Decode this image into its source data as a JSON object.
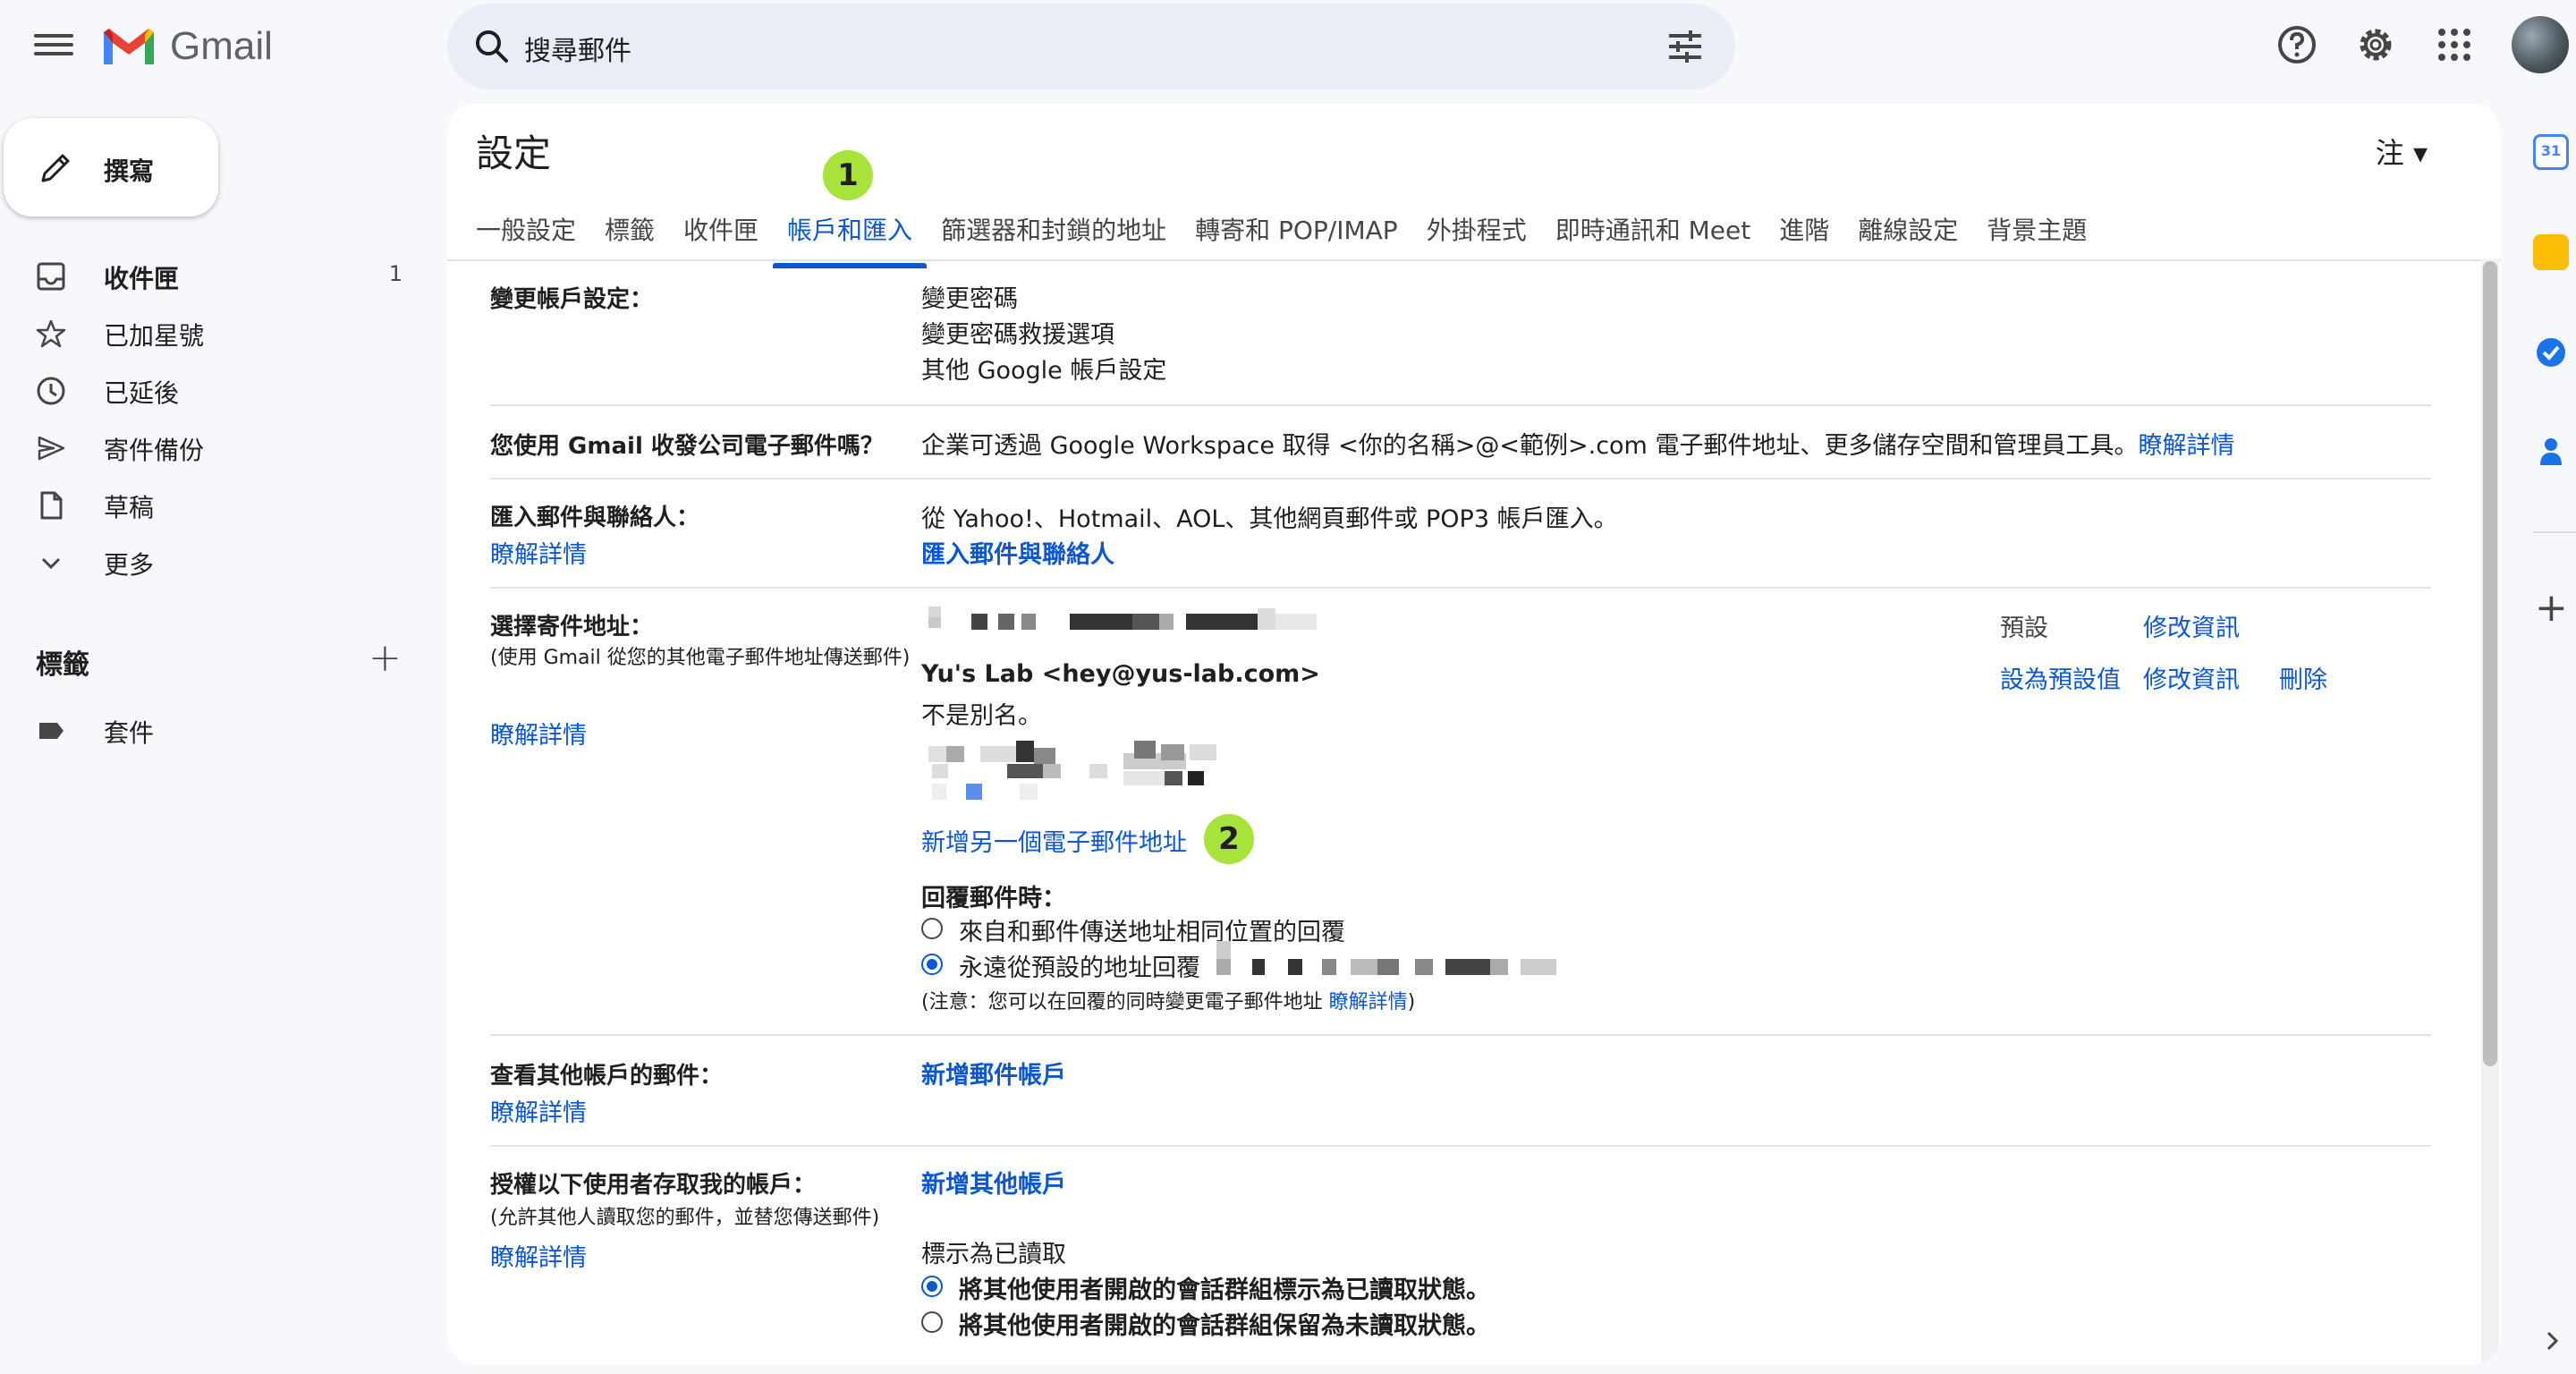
{
  "app": {
    "name": "Gmail"
  },
  "search": {
    "placeholder": "搜尋郵件"
  },
  "sidebar": {
    "compose_label": "撰寫",
    "items": [
      {
        "icon": "inbox-icon",
        "label": "收件匣",
        "count": "1",
        "bold": true
      },
      {
        "icon": "star-icon",
        "label": "已加星號",
        "count": ""
      },
      {
        "icon": "clock-icon",
        "label": "已延後",
        "count": ""
      },
      {
        "icon": "send-icon",
        "label": "寄件備份",
        "count": ""
      },
      {
        "icon": "draft-icon",
        "label": "草稿",
        "count": ""
      },
      {
        "icon": "chevron-down-icon",
        "label": "更多",
        "count": ""
      }
    ],
    "labels_title": "標籤",
    "labels": [
      {
        "label": "套件"
      }
    ]
  },
  "settings": {
    "title": "設定",
    "lang": "注",
    "tabs": [
      "一般設定",
      "標籤",
      "收件匣",
      "帳戶和匯入",
      "篩選器和封鎖的地址",
      "轉寄和 POP/IMAP",
      "外掛程式",
      "即時通訊和 Meet",
      "進階",
      "離線設定",
      "背景主題"
    ],
    "active_tab": 3,
    "markers": [
      "1",
      "2"
    ],
    "account": {
      "label": "變更帳戶設定：",
      "links": [
        "變更密碼",
        "變更密碼救援選項",
        "其他 Google 帳戶設定"
      ]
    },
    "workspace": {
      "label": "您使用 Gmail 收發公司電子郵件嗎？",
      "text": "企業可透過 Google Workspace 取得 <你的名稱>@<範例>.com 電子郵件地址、更多儲存空間和管理員工具。",
      "link": "瞭解詳情"
    },
    "import": {
      "label": "匯入郵件與聯絡人：",
      "learn": "瞭解詳情",
      "text": "從 Yahoo!、Hotmail、AOL、其他網頁郵件或 POP3 帳戶匯入。",
      "action": "匯入郵件與聯絡人"
    },
    "send_as": {
      "label": "選擇寄件地址：",
      "sub": "(使用 Gmail 從您的其他電子郵件地址傳送郵件)",
      "learn": "瞭解詳情",
      "default_label": "預設",
      "edit": "修改資訊",
      "address2": "Yu's Lab <hey@yus-lab.com>",
      "not_alias": "不是別名。",
      "set_default": "設為預設值",
      "edit2": "修改資訊",
      "delete": "刪除",
      "add": "新增另一個電子郵件地址",
      "reply_title": "回覆郵件時：",
      "reply_opt1": "來自和郵件傳送地址相同位置的回覆",
      "reply_opt2": "永遠從預設的地址回覆",
      "note": "(注意：您可以在回覆的同時變更電子郵件地址",
      "note_link": "瞭解詳情",
      "note_end": ")"
    },
    "check_mail": {
      "label": "查看其他帳戶的郵件：",
      "learn": "瞭解詳情",
      "action": "新增郵件帳戶"
    },
    "grant": {
      "label": "授權以下使用者存取我的帳戶：",
      "sub": "(允許其他人讀取您的郵件，並替您傳送郵件)",
      "learn": "瞭解詳情",
      "action": "新增其他帳戶",
      "mark_title": "標示為已讀取",
      "opt1": "將其他使用者開啟的會話群組標示為已讀取狀態。",
      "opt2": "將其他使用者開啟的會話群組保留為未讀取狀態。"
    }
  }
}
